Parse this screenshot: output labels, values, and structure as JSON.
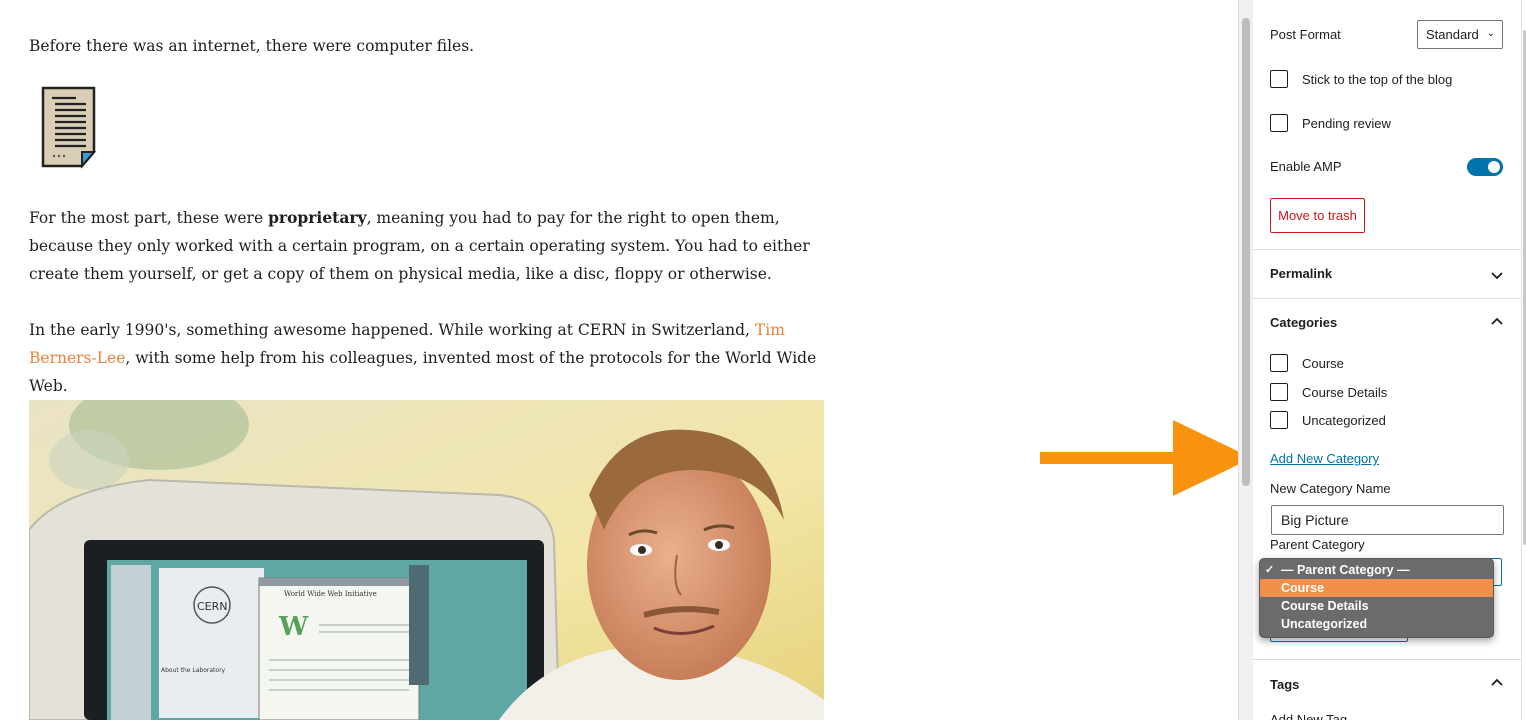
{
  "content": {
    "para1": "Before there was an internet, there were computer files.",
    "para2_before": "For the most part, these were ",
    "para2_bold": "proprietary",
    "para2_after": ", meaning you had to pay for the right to open them, because they only worked with a certain program, on a certain operating system. You had to either create them yourself, or get a copy of them on physical media, like a disc, floppy or otherwise.",
    "para3_before": "In the early 1990's, something awesome happened. While working at CERN in Switzerland, ",
    "para3_link": "Tim Berners-Lee",
    "para3_after": ", with some help from his colleagues, invented most of the protocols for the World Wide Web.",
    "doc_icon": "document-icon",
    "photo_screen_texts": [
      "CERN",
      "World Wide Web Initiative",
      "W",
      "About the Laboratory"
    ]
  },
  "sidebar": {
    "post_format_label": "Post Format",
    "post_format_value": "Standard",
    "stick_top_label": "Stick to the top of the blog",
    "pending_review_label": "Pending review",
    "enable_amp_label": "Enable AMP",
    "enable_amp_on": true,
    "move_to_trash_label": "Move to trash",
    "permalink_title": "Permalink",
    "categories_title": "Categories",
    "categories": [
      {
        "label": "Course",
        "checked": false
      },
      {
        "label": "Course Details",
        "checked": false
      },
      {
        "label": "Uncategorized",
        "checked": false
      }
    ],
    "add_new_category_link": "Add New Category",
    "new_category_name_label": "New Category Name",
    "new_category_name_value": "Big Picture",
    "parent_category_label": "Parent Category",
    "parent_category_options": [
      {
        "label": "— Parent Category —",
        "selected": true
      },
      {
        "label": "Course",
        "highlighted": true
      },
      {
        "label": "Course Details"
      },
      {
        "label": "Uncategorized"
      }
    ],
    "tags_title": "Tags",
    "tags_partial_label": "Add New Tag"
  },
  "colors": {
    "accent_blue": "#0073aa",
    "trash_red": "#cc1818",
    "link_orange": "#e8833a",
    "arrow_orange": "#f7930f",
    "dropdown_highlight": "#f0904a"
  }
}
